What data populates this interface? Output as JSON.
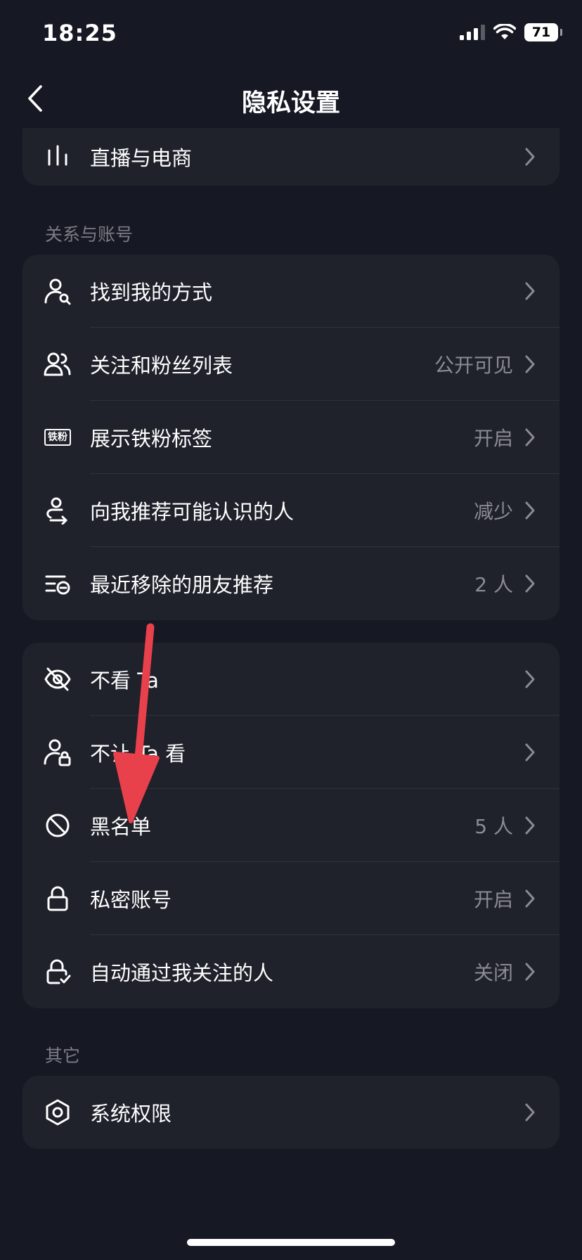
{
  "status_bar": {
    "time": "18:25",
    "battery": "71"
  },
  "nav": {
    "title": "隐私设置"
  },
  "top_card": {
    "items": [
      {
        "label": "直播与电商",
        "value": "",
        "icon": "bar-chart-icon"
      }
    ]
  },
  "section_relations": {
    "title": "关系与账号",
    "items": [
      {
        "label": "找到我的方式",
        "value": "",
        "icon": "user-search-icon"
      },
      {
        "label": "关注和粉丝列表",
        "value": "公开可见",
        "icon": "users-icon"
      },
      {
        "label": "展示铁粉标签",
        "value": "开启",
        "icon": "fan-badge-icon",
        "badge_text": "铁粉"
      },
      {
        "label": "向我推荐可能认识的人",
        "value": "减少",
        "icon": "recommend-people-icon"
      },
      {
        "label": "最近移除的朋友推荐",
        "value": "2 人",
        "icon": "removed-list-icon"
      }
    ]
  },
  "section_block": {
    "items": [
      {
        "label": "不看 Ta",
        "value": "",
        "icon": "eye-off-icon"
      },
      {
        "label": "不让 Ta 看",
        "value": "",
        "icon": "user-lock-icon"
      },
      {
        "label": "黑名单",
        "value": "5 人",
        "icon": "block-icon"
      },
      {
        "label": "私密账号",
        "value": "开启",
        "icon": "lock-icon"
      },
      {
        "label": "自动通过我关注的人",
        "value": "关闭",
        "icon": "lock-check-icon"
      }
    ]
  },
  "section_other": {
    "title": "其它",
    "items": [
      {
        "label": "系统权限",
        "value": "",
        "icon": "settings-hexagon-icon"
      }
    ]
  },
  "colors": {
    "background": "#161823",
    "card": "#1f212b",
    "secondary_text": "#8a8b93",
    "annotation_arrow": "#e8414b"
  }
}
